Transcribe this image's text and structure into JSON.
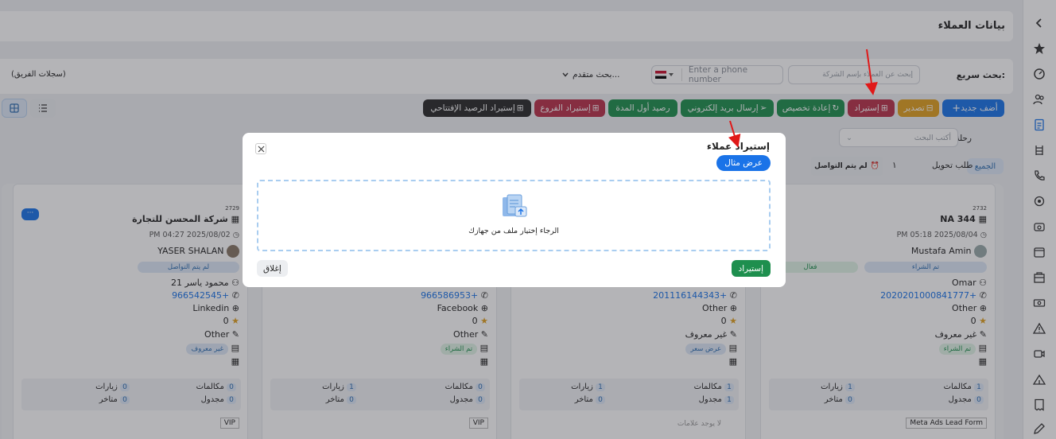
{
  "header": {
    "title": "بيانات العملاء"
  },
  "search": {
    "quick_label": "بحث سريع:",
    "company_placeholder": "إبحث عن العملاء بإسم الشركة",
    "phone_placeholder": "Enter a phone number",
    "advanced_label": "بحث متقدم...",
    "team_records": "(سجلات الفريق)"
  },
  "toolbar": {
    "add_new": "أضف جديد",
    "export": "تصدير",
    "import": "إستيراد",
    "reassign": "إعادة تخصيص",
    "send_email": "إرسال بريد إلكتروني",
    "opening_balance": "رصيد أول المدة",
    "import_branches": "إستيراد الفروع",
    "import_opening_balance": "إستيراد الرصيد الإفتتاحي"
  },
  "journey": {
    "label": "رحلة العميل",
    "placeholder": "أكتب البحث"
  },
  "filters": {
    "all": "الجميع",
    "transfer_request": "طلب تحويل",
    "transfer_count": "١",
    "not_contacted": "لم يتم التواصل"
  },
  "cards": [
    {
      "id": "2732",
      "name": "NA 344",
      "datetime": "PM 05:18 2025/08/04",
      "owner": "Mustafa Amin",
      "status": "تم الشراء",
      "status2": "فعال",
      "contact": "Omar",
      "phone": "2020201000841777+",
      "source": "Other",
      "rating": "0",
      "field_a": "غير معروف",
      "field_b": "تم الشراء",
      "calls": "1",
      "visits": "1",
      "scheduled": "0",
      "late": "0",
      "calls_label": "مكالمات",
      "visits_label": "زيارات",
      "scheduled_label": "مجدول",
      "late_label": "متاخر",
      "tag": "Meta Ads Lead Form"
    },
    {
      "id": "",
      "name": "",
      "datetime": "",
      "owner": "",
      "status": "",
      "status2": "",
      "contact": "",
      "phone": "201116144343+",
      "source": "Other",
      "rating": "0",
      "field_a": "غير معروف",
      "field_b": "عرض سعر",
      "calls": "1",
      "visits": "1",
      "scheduled": "1",
      "late": "0",
      "calls_label": "مكالمات",
      "visits_label": "زيارات",
      "scheduled_label": "مجدول",
      "late_label": "متاخر",
      "tag": "لا يوجد علامات"
    },
    {
      "id": "",
      "name": "",
      "datetime": "",
      "owner": "",
      "status": "",
      "status2": "",
      "contact": "",
      "phone": "966586953+",
      "source": "Facebook",
      "rating": "0",
      "field_a": "Other",
      "field_b": "تم الشراء",
      "calls": "0",
      "visits": "1",
      "scheduled": "0",
      "late": "0",
      "calls_label": "مكالمات",
      "visits_label": "زيارات",
      "scheduled_label": "مجدول",
      "late_label": "متاخر",
      "tag": "VIP"
    },
    {
      "id": "2729",
      "name": "شركة المحسن للتجارة",
      "datetime": "PM 04:27 2025/08/02",
      "owner": "YASER SHALAN",
      "status": "لم يتم التواصل",
      "status2": "",
      "contact": "محمود ياسر 21",
      "phone": "966542545+",
      "source": "Linkedin",
      "rating": "0",
      "field_a": "Other",
      "field_b": "غير معروف",
      "calls": "0",
      "visits": "0",
      "scheduled": "0",
      "late": "0",
      "calls_label": "مكالمات",
      "visits_label": "زيارات",
      "scheduled_label": "مجدول",
      "late_label": "متاخر",
      "tag": "VIP"
    }
  ],
  "modal": {
    "title": "إستيراد عملاء",
    "sample_button": "عرض مثال",
    "dropzone_text": "الرجاء إختيار ملف من جهازك",
    "import_button": "إستيراد",
    "close_button": "إغلاق"
  },
  "colors": {
    "primary": "#1a73e8",
    "green": "#1e8f4e",
    "maroon": "#b8324a",
    "orange": "#e0a020",
    "dark": "#2a2a2a"
  }
}
